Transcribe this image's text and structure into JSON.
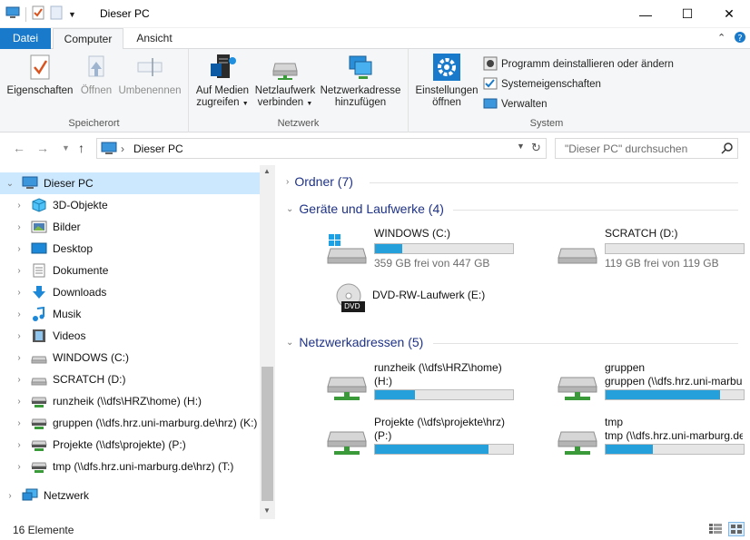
{
  "window": {
    "title": "Dieser PC",
    "minimize": "—",
    "maximize": "☐",
    "close": "✕"
  },
  "ribbon_tabs": {
    "file": "Datei",
    "computer": "Computer",
    "view": "Ansicht"
  },
  "ribbon": {
    "location": {
      "label": "Speicherort",
      "properties": "Eigenschaften",
      "open": "Öffnen",
      "rename": "Umbenennen"
    },
    "network": {
      "label": "Netzwerk",
      "media_access_1": "Auf Medien",
      "media_access_2": "zugreifen",
      "map_drive_1": "Netzlaufwerk",
      "map_drive_2": "verbinden",
      "add_location_1": "Netzwerkadresse",
      "add_location_2": "hinzufügen"
    },
    "system": {
      "label": "System",
      "settings_1": "Einstellungen",
      "settings_2": "öffnen",
      "uninstall": "Programm deinstallieren oder ändern",
      "properties": "Systemeigenschaften",
      "manage": "Verwalten"
    }
  },
  "address": {
    "path": "Dieser PC",
    "separator": "›",
    "search_placeholder": "\"Dieser PC\" durchsuchen"
  },
  "nav_tree": {
    "root": "Dieser PC",
    "items": [
      {
        "label": "3D-Objekte",
        "icon": "cube-icon"
      },
      {
        "label": "Bilder",
        "icon": "pictures-icon"
      },
      {
        "label": "Desktop",
        "icon": "desktop-icon"
      },
      {
        "label": "Dokumente",
        "icon": "documents-icon"
      },
      {
        "label": "Downloads",
        "icon": "download-icon"
      },
      {
        "label": "Musik",
        "icon": "music-icon"
      },
      {
        "label": "Videos",
        "icon": "videos-icon"
      },
      {
        "label": "WINDOWS (C:)",
        "icon": "drive-icon"
      },
      {
        "label": "SCRATCH (D:)",
        "icon": "drive-icon"
      },
      {
        "label": "runzheik (\\\\dfs\\HRZ\\home) (H:)",
        "icon": "network-drive-icon"
      },
      {
        "label": "gruppen (\\\\dfs.hrz.uni-marburg.de\\hrz) (K:)",
        "icon": "network-drive-icon"
      },
      {
        "label": "Projekte (\\\\dfs\\projekte) (P:)",
        "icon": "network-drive-icon"
      },
      {
        "label": "tmp (\\\\dfs.hrz.uni-marburg.de\\hrz) (T:)",
        "icon": "network-drive-icon"
      }
    ],
    "network": "Netzwerk"
  },
  "content": {
    "folders_header": "Ordner (7)",
    "devices_header": "Geräte und Laufwerke (4)",
    "network_header": "Netzwerkadressen (5)",
    "drives": [
      {
        "name": "WINDOWS (C:)",
        "info": "359 GB frei von 447 GB",
        "used_fraction": 0.2
      },
      {
        "name": "SCRATCH (D:)",
        "info": "119 GB frei von 119 GB",
        "used_fraction": 0.0
      },
      {
        "name": "DVD-RW-Laufwerk (E:)",
        "badge": "DVD"
      }
    ],
    "network_locations": [
      {
        "name": "runzheik (\\\\dfs\\HRZ\\home)",
        "letter": "(H:)",
        "used_fraction": 0.29
      },
      {
        "name": "gruppen (\\\\dfs.hrz.uni-marburg.de...",
        "letter": "",
        "used_fraction": 0.83
      },
      {
        "name": "Projekte (\\\\dfs\\projekte\\hrz)",
        "letter": "(P:)",
        "used_fraction": 0.82
      },
      {
        "name": "tmp (\\\\dfs.hrz.uni-marburg.de...",
        "letter": "",
        "used_fraction": 0.34
      }
    ]
  },
  "status": {
    "count": "16 Elemente"
  },
  "colors": {
    "accent": "#1979ca",
    "selection": "#cce8ff",
    "bar_fill": "#26a0da",
    "section_header": "#1e3287"
  }
}
